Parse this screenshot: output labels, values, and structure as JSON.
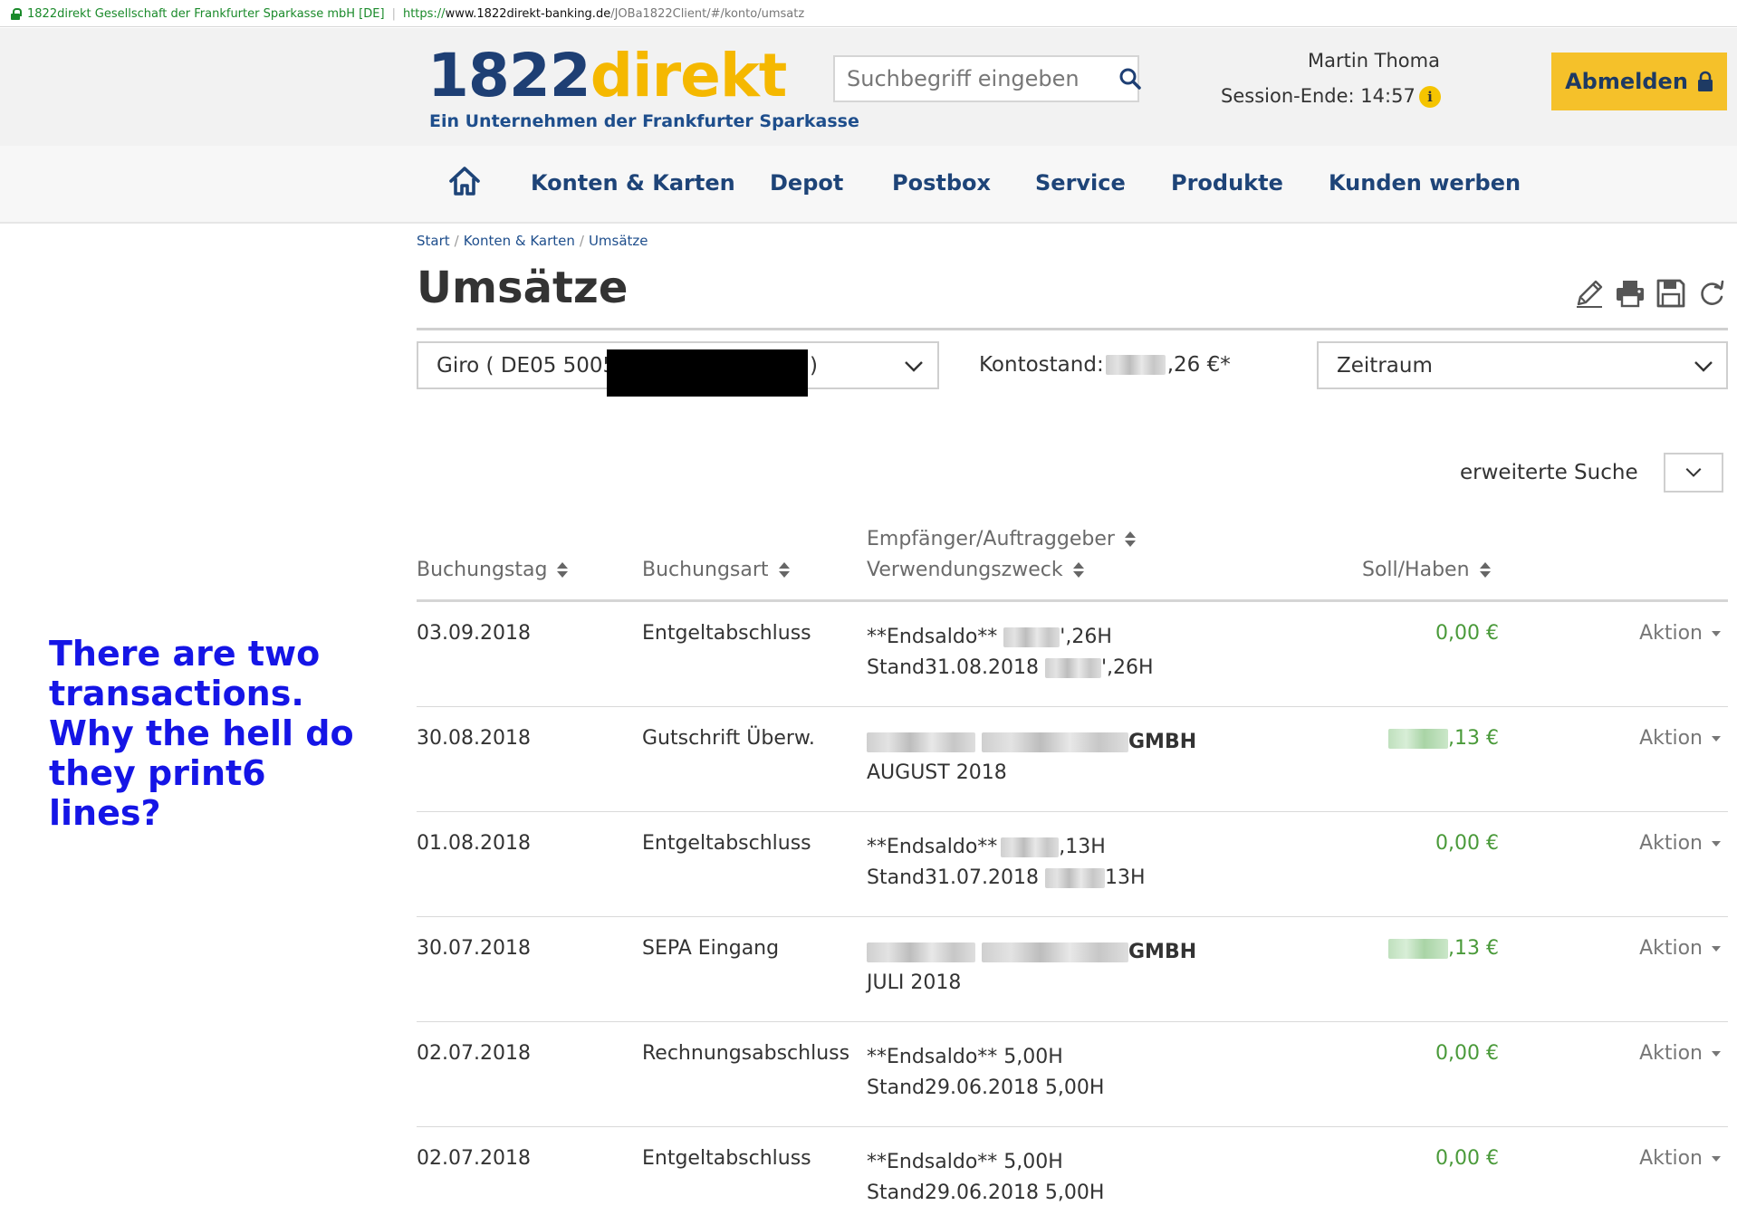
{
  "browser": {
    "site_owner": "1822direkt Gesellschaft der Frankfurter Sparkasse mbH [DE]",
    "url_scheme": "https://",
    "url_host": "www.1822direkt-banking.de",
    "url_path": "/JOBa1822Client/#/konto/umsatz"
  },
  "header": {
    "logo_number": "1822",
    "logo_word": "direkt",
    "logo_tagline": "Ein Unternehmen der Frankfurter Sparkasse",
    "search_placeholder": "Suchbegriff eingeben",
    "user_name": "Martin Thoma",
    "session_end": "Session-Ende: 14:57",
    "info_icon_glyph": "i",
    "logout_label": "Abmelden"
  },
  "nav": {
    "items": [
      "Konten & Karten",
      "Depot",
      "Postbox",
      "Service",
      "Produkte",
      "Kunden werben"
    ]
  },
  "breadcrumb": [
    "Start",
    "Konten & Karten",
    "Umsätze"
  ],
  "page_title": "Umsätze",
  "toolbar_icons": [
    "pencil-icon",
    "printer-icon",
    "save-icon",
    "refresh-icon"
  ],
  "filters": {
    "account_value_prefix": "Giro ( DE05 5005",
    "account_value_suffix": ")",
    "balance_label": "Kontostand:",
    "balance_value_suffix": ",26 €*",
    "period_label": "Zeitraum",
    "advanced_search_label": "erweiterte Suche"
  },
  "table": {
    "headers": {
      "date": "Buchungstag",
      "type": "Buchungsart",
      "recipient": "Empfänger/Auftraggeber",
      "purpose": "Verwendungszweck",
      "amount": "Soll/Haben"
    },
    "action_label": "Aktion",
    "rows": [
      {
        "date": "03.09.2018",
        "type": "Entgeltabschluss",
        "line1": "**Endsaldo**",
        "line1_suffix": "',26H",
        "line2": "Stand31.08.2018",
        "line2_suffix": "',26H",
        "amount": "0,00 €"
      },
      {
        "date": "30.08.2018",
        "type": "Gutschrift Überw.",
        "line1": "",
        "line1_suffix": "GMBH",
        "line2": "AUGUST 2018",
        "line2_suffix": "",
        "amount": ",13 €"
      },
      {
        "date": "01.08.2018",
        "type": "Entgeltabschluss",
        "line1": "**Endsaldo**",
        "line1_suffix": ",13H",
        "line2": "Stand31.07.2018",
        "line2_suffix": "13H",
        "amount": "0,00 €"
      },
      {
        "date": "30.07.2018",
        "type": "SEPA Eingang",
        "line1": "",
        "line1_suffix": "GMBH",
        "line2": "JULI 2018",
        "line2_suffix": "",
        "amount": ",13 €"
      },
      {
        "date": "02.07.2018",
        "type": "Rechnungsabschluss",
        "line1": "**Endsaldo** 5,00H",
        "line1_suffix": "",
        "line2": "Stand29.06.2018 5,00H",
        "line2_suffix": "",
        "amount": "0,00 €"
      },
      {
        "date": "02.07.2018",
        "type": "Entgeltabschluss",
        "line1": "**Endsaldo** 5,00H",
        "line1_suffix": "",
        "line2": "Stand29.06.2018 5,00H",
        "line2_suffix": "",
        "amount": "0,00 €"
      }
    ]
  },
  "annotation": "There are two transactions. Why the hell do they print6 lines?",
  "colors": {
    "brand_blue": "#1e3f74",
    "brand_yellow": "#f5b800",
    "logout_button": "#f5c12a",
    "amount_green": "#4a9a3a",
    "annotation_blue": "#1515e6"
  }
}
